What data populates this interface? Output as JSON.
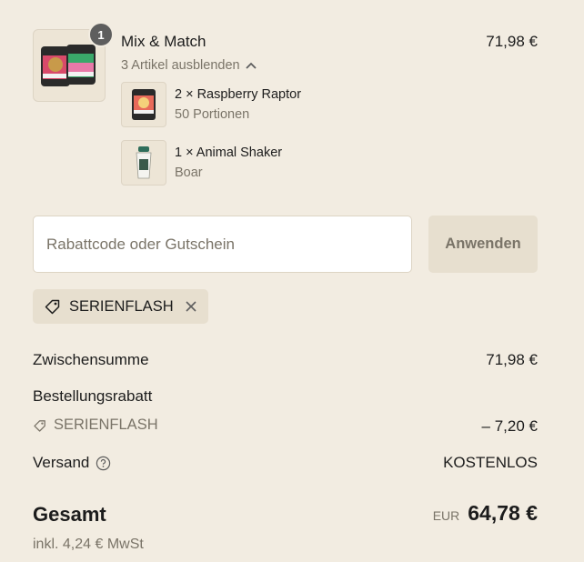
{
  "cart_item": {
    "quantity_badge": "1",
    "title": "Mix & Match",
    "price": "71,98 €",
    "toggle_label": "3 Artikel ausblenden",
    "sub_items": [
      {
        "name": "2 × Raspberry Raptor",
        "variant": "50 Portionen"
      },
      {
        "name": "1 × Animal Shaker",
        "variant": "Boar"
      }
    ]
  },
  "discount": {
    "placeholder": "Rabattcode oder Gutschein",
    "value": "",
    "apply_label": "Anwenden",
    "applied_code": "SERIENFLASH"
  },
  "summary": {
    "subtotal_label": "Zwischensumme",
    "subtotal_value": "71,98 €",
    "order_discount_label": "Bestellungsrabatt",
    "order_discount_code": "SERIENFLASH",
    "order_discount_value": "– 7,20 €",
    "shipping_label": "Versand",
    "shipping_value": "KOSTENLOS",
    "total_label": "Gesamt",
    "total_currency": "EUR",
    "total_value": "64,78 €",
    "tax_note": "inkl. 4,24 € MwSt"
  },
  "icons": {
    "chevron": "chevron-up-icon",
    "tag": "tag-icon",
    "close": "close-icon",
    "help": "help-circle-icon"
  },
  "colors": {
    "background": "#f2ece1",
    "muted_text": "#7a7468",
    "chip_bg": "#e7dfcf",
    "badge_bg": "#5e5e5e"
  }
}
